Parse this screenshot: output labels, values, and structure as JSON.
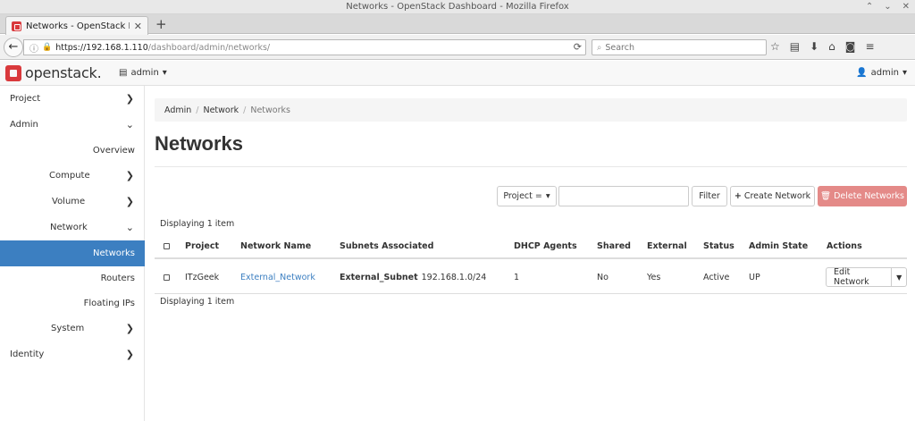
{
  "window": {
    "title": "Networks - OpenStack Dashboard - Mozilla Firefox",
    "controls": [
      "⌃",
      "⌄",
      "✕"
    ]
  },
  "browser": {
    "tab_title": "Networks - OpenStack Dasl",
    "new_tab": "+",
    "url_host": "https://192.168.1.110",
    "url_path": "/dashboard/admin/networks/",
    "search_placeholder": "Search"
  },
  "header": {
    "logo_text": "openstack.",
    "project_label": "admin",
    "user_label": "admin"
  },
  "sidebar": {
    "project": "Project",
    "admin": "Admin",
    "overview": "Overview",
    "compute": "Compute",
    "volume": "Volume",
    "network": "Network",
    "networks": "Networks",
    "routers": "Routers",
    "floating_ips": "Floating IPs",
    "system": "System",
    "identity": "Identity"
  },
  "breadcrumb": {
    "items": [
      "Admin",
      "Network",
      "Networks"
    ]
  },
  "page": {
    "title": "Networks"
  },
  "filter": {
    "field_label": "Project =",
    "filter_button": "Filter",
    "create_button": "Create Network",
    "delete_button": "Delete Networks"
  },
  "table": {
    "displaying_top": "Displaying 1 item",
    "displaying_bottom": "Displaying 1 item",
    "headers": {
      "project": "Project",
      "network_name": "Network Name",
      "subnets": "Subnets Associated",
      "dhcp": "DHCP Agents",
      "shared": "Shared",
      "external": "External",
      "status": "Status",
      "admin_state": "Admin State",
      "actions": "Actions"
    },
    "rows": [
      {
        "project": "ITzGeek",
        "network_name": "External_Network",
        "subnet_name": "External_Subnet",
        "subnet_cidr": "192.168.1.0/24",
        "dhcp": "1",
        "shared": "No",
        "external": "Yes",
        "status": "Active",
        "admin_state": "UP",
        "action": "Edit Network"
      }
    ]
  },
  "colors": {
    "sidebar_active": "#3c7fc1",
    "link": "#3c7fc1",
    "danger": "#e48a88",
    "logo": "#d9393c"
  }
}
